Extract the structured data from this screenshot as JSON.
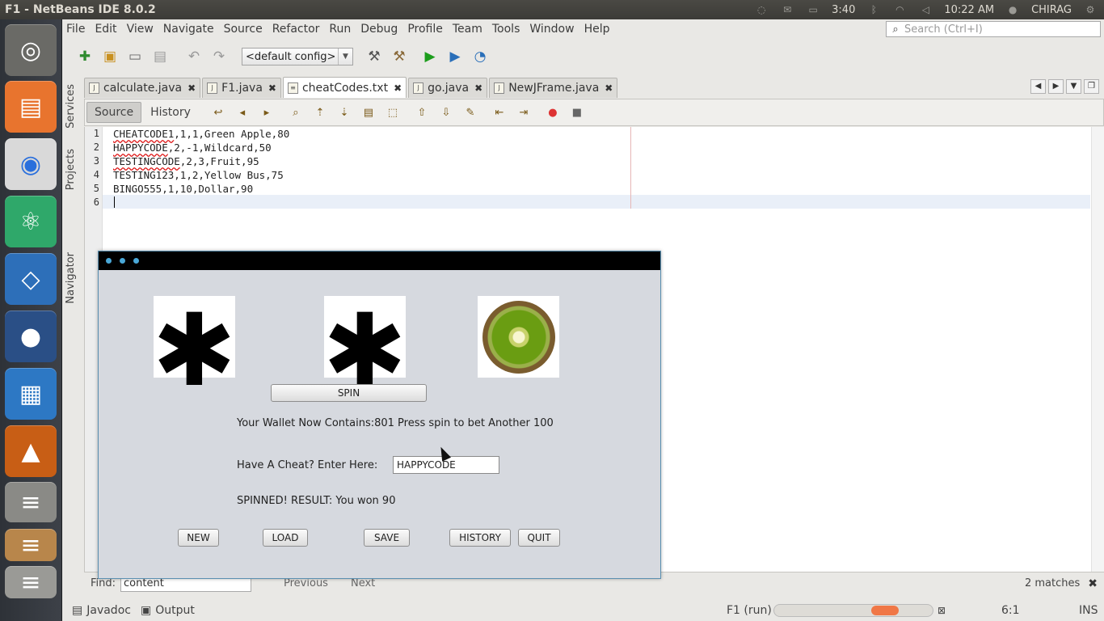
{
  "window": {
    "title": "F1 - NetBeans IDE 8.0.2"
  },
  "tray": {
    "battery": "3:40",
    "clock": "10:22 AM",
    "user": "CHIRAG"
  },
  "menu": [
    "File",
    "Edit",
    "View",
    "Navigate",
    "Source",
    "Refactor",
    "Run",
    "Debug",
    "Profile",
    "Team",
    "Tools",
    "Window",
    "Help"
  ],
  "search": {
    "placeholder": "Search (Ctrl+I)"
  },
  "toolbar": {
    "config": "<default config>"
  },
  "side_tabs": {
    "services": "Services",
    "projects": "Projects",
    "navigator": "Navigator"
  },
  "tabs": [
    {
      "label": "calculate.java"
    },
    {
      "label": "F1.java"
    },
    {
      "label": "cheatCodes.txt"
    },
    {
      "label": "go.java"
    },
    {
      "label": "NewJFrame.java"
    }
  ],
  "editor_modes": {
    "source": "Source",
    "history": "History"
  },
  "code_lines": [
    {
      "n": "1",
      "word": "CHEATCODE1",
      "rest": ",1,1,Green Apple,80"
    },
    {
      "n": "2",
      "word": "HAPPYCODE",
      "rest": ",2,-1,Wildcard,50"
    },
    {
      "n": "3",
      "word": "TESTINGCODE",
      "rest": ",2,3,Fruit,95"
    },
    {
      "n": "4",
      "word": "TESTING123",
      "rest": ",1,2,Yellow Bus,75"
    },
    {
      "n": "5",
      "word": "BINGO555",
      "rest": ",1,10,Dollar,90"
    },
    {
      "n": "6",
      "word": "",
      "rest": ""
    }
  ],
  "findbar": {
    "label": "Find:",
    "value": "content",
    "previous": "Previous",
    "next": "Next",
    "matches": "2 matches"
  },
  "statusbar": {
    "javadoc": "Javadoc",
    "output": "Output",
    "run": "F1 (run)",
    "position": "6:1",
    "mode": "INS"
  },
  "slot_game": {
    "spin": "SPIN",
    "wallet": "Your Wallet Now Contains:801 Press spin to bet Another 100",
    "cheat_label": "Have A Cheat? Enter Here:",
    "cheat_value": "HAPPYCODE",
    "result": "SPINNED! RESULT: You won 90",
    "buttons": {
      "new": "NEW",
      "load": "LOAD",
      "save": "SAVE",
      "history": "HISTORY",
      "quit": "QUIT"
    },
    "slots": [
      "asterisk-icon",
      "asterisk-icon",
      "kiwi-fruit-image"
    ]
  }
}
